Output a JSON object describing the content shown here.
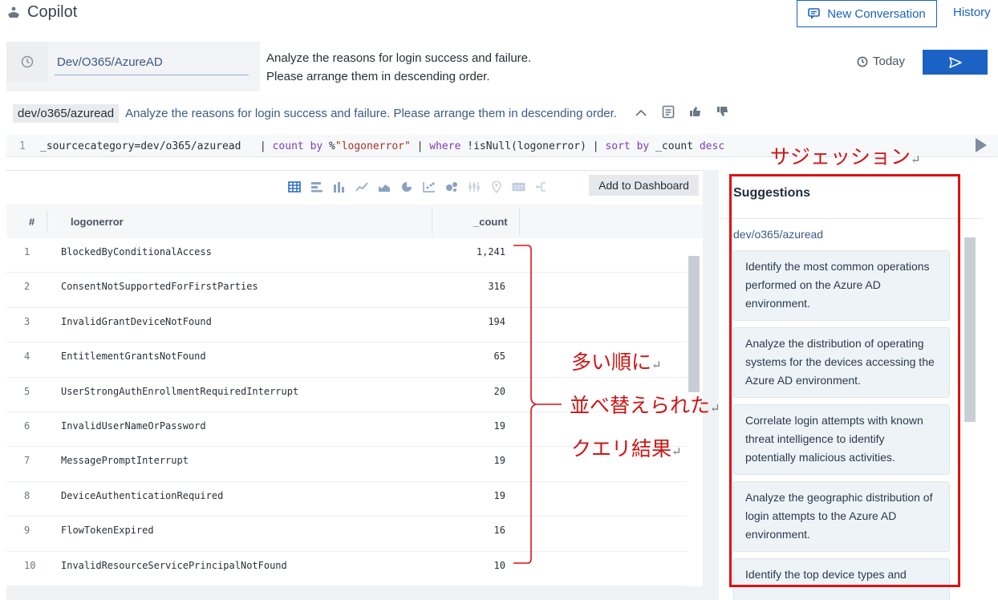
{
  "header": {
    "app_title": "Copilot",
    "new_conversation": "New Conversation",
    "history": "History"
  },
  "prompt": {
    "scope_value": "Dev/O365/AzureAD",
    "line1": "Analyze the reasons for login success and failure.",
    "line2": "Please arrange them in descending order.",
    "time_range": "Today"
  },
  "summary": {
    "scope": "dev/o365/azuread",
    "text": "Analyze the reasons for login success and failure. Please arrange them in descending order."
  },
  "query": {
    "line_number": "1",
    "segments": [
      {
        "t": "_sourcecategory=dev/o365/azuread   | ",
        "k": "plain"
      },
      {
        "t": "count",
        "k": "kw"
      },
      {
        "t": " ",
        "k": "plain"
      },
      {
        "t": "by",
        "k": "kw"
      },
      {
        "t": " %",
        "k": "plain"
      },
      {
        "t": "\"logonerror\"",
        "k": "str"
      },
      {
        "t": " | ",
        "k": "plain"
      },
      {
        "t": "where",
        "k": "kw"
      },
      {
        "t": " !isNull(logonerror) | ",
        "k": "plain"
      },
      {
        "t": "sort by",
        "k": "kw"
      },
      {
        "t": " _count ",
        "k": "plain"
      },
      {
        "t": "desc",
        "k": "kw"
      }
    ]
  },
  "results": {
    "add_to_dashboard": "Add to Dashboard",
    "columns": {
      "num": "#",
      "error": "logonerror",
      "count": "_count"
    },
    "rows": [
      {
        "n": "1",
        "error": "BlockedByConditionalAccess",
        "count": "1,241"
      },
      {
        "n": "2",
        "error": "ConsentNotSupportedForFirstParties",
        "count": "316"
      },
      {
        "n": "3",
        "error": "InvalidGrantDeviceNotFound",
        "count": "194"
      },
      {
        "n": "4",
        "error": "EntitlementGrantsNotFound",
        "count": "65"
      },
      {
        "n": "5",
        "error": "UserStrongAuthEnrollmentRequiredInterrupt",
        "count": "20"
      },
      {
        "n": "6",
        "error": "InvalidUserNameOrPassword",
        "count": "19"
      },
      {
        "n": "7",
        "error": "MessagePromptInterrupt",
        "count": "19"
      },
      {
        "n": "8",
        "error": "DeviceAuthenticationRequired",
        "count": "19"
      },
      {
        "n": "9",
        "error": "FlowTokenExpired",
        "count": "16"
      },
      {
        "n": "10",
        "error": "InvalidResourceServicePrincipalNotFound",
        "count": "10"
      }
    ]
  },
  "suggestions": {
    "title": "Suggestions",
    "scope": "dev/o365/azuread",
    "items": [
      "Identify the most common operations performed on the Azure AD environment.",
      "Analyze the distribution of operating systems for the devices accessing the Azure AD environment.",
      "Correlate login attempts with known threat intelligence to identify potentially malicious activities.",
      "Analyze the geographic distribution of login attempts to the Azure AD environment.",
      "Identify the top device types and"
    ]
  },
  "annotations": {
    "suggestion_label": "サジェッション",
    "result_line1": "多い順に",
    "result_line2": "並べ替えられた",
    "result_line3": "クエリ結果",
    "return_mark": "↵",
    "color": "#e01010"
  }
}
